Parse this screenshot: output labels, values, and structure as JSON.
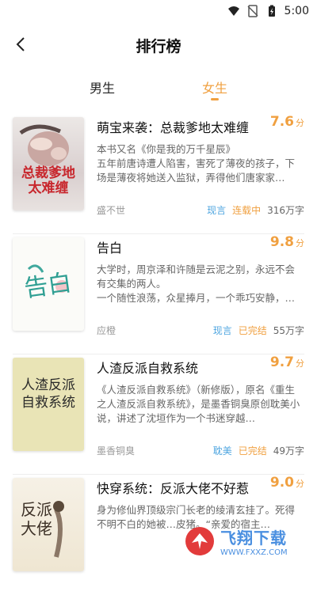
{
  "status": {
    "time": "5:00"
  },
  "header": {
    "title": "排行榜"
  },
  "tabs": [
    {
      "label": "男生"
    },
    {
      "label": "女生"
    }
  ],
  "books": [
    {
      "title": "萌宝来袭：总裁爹地太难缠",
      "score": "7.6",
      "unit": "分",
      "desc": "本书又名《你是我的万千星辰》\n五年前唐诗遭人陷害，害死了薄夜的孩子，下场是薄夜将她送入监狱，弄得他们唐家家…",
      "author": "盛不世",
      "genre": "现言",
      "status": "连载中",
      "words": "316万字",
      "cover_text": "总裁爹地太难缠"
    },
    {
      "title": "告白",
      "score": "9.8",
      "unit": "分",
      "desc": "大学时，周京泽和许随是云泥之别，永远不会有交集的两人。\n一个随性浪荡，众星捧月，一个乖巧安静，…",
      "author": "应橙",
      "genre": "现言",
      "status": "已完结",
      "words": "55万字",
      "cover_text": "告白"
    },
    {
      "title": "人渣反派自救系统",
      "score": "9.7",
      "unit": "分",
      "desc": "《人渣反派自救系统》（新修版），原名《重生之人渣反派自救系统》，是墨香铜臭原创耽美小说，讲述了沈垣作为一个书迷穿越…",
      "author": "墨香铜臭",
      "genre": "耽美",
      "status": "已完结",
      "words": "49万字",
      "cover_text": "人渣反派自救系统"
    },
    {
      "title": "快穿系统：反派大佬不好惹",
      "score": "9.0",
      "unit": "分",
      "desc": "身为修仙界顶级宗门长老的绫清玄挂了。死得不明不白的她被…皮猪。“亲爱的宿主…",
      "author": "",
      "genre": "",
      "status": "",
      "words": "",
      "cover_text": "反派大佬"
    }
  ],
  "watermark": {
    "brand": "飞翔下载",
    "url": "WWW.FXXZ.COM"
  },
  "colors": {
    "accent": "#f0a040",
    "genre": "#4fa6e0"
  }
}
